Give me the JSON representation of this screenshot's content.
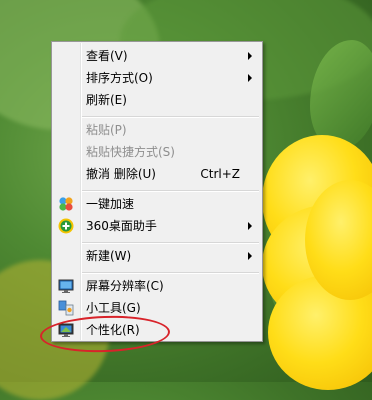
{
  "menu": {
    "items": [
      {
        "label": "查看(V)",
        "submenu": true
      },
      {
        "label": "排序方式(O)",
        "submenu": true
      },
      {
        "label": "刷新(E)"
      },
      {
        "label": "粘贴(P)",
        "disabled": true
      },
      {
        "label": "粘贴快捷方式(S)",
        "disabled": true
      },
      {
        "label": "撤消 删除(U)",
        "shortcut": "Ctrl+Z"
      },
      {
        "label": "一键加速",
        "icon": "speedup-icon"
      },
      {
        "label": "360桌面助手",
        "icon": "360-assistant-icon",
        "submenu": true
      },
      {
        "label": "新建(W)",
        "submenu": true
      },
      {
        "label": "屏幕分辨率(C)",
        "icon": "screen-resolution-icon"
      },
      {
        "label": "小工具(G)",
        "icon": "gadgets-icon"
      },
      {
        "label": "个性化(R)",
        "icon": "personalize-icon"
      }
    ]
  },
  "colors": {
    "annotation": "#d8232a",
    "menu_bg": "#f0f0f0",
    "disabled_text": "#8e8e8e"
  }
}
